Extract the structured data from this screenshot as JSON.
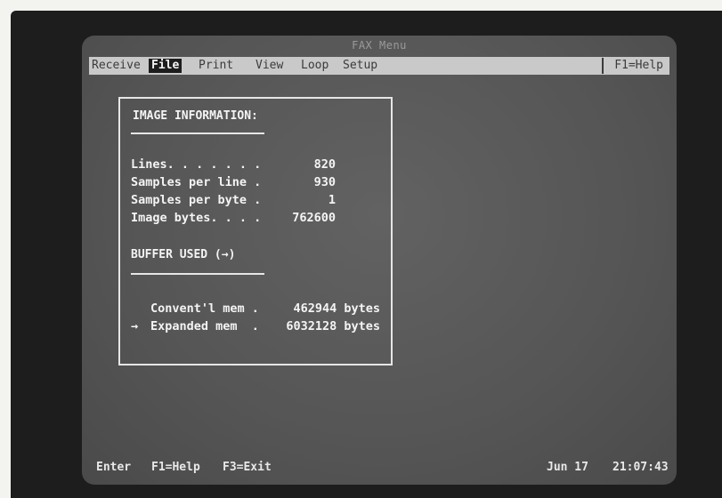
{
  "window": {
    "title": "FAX Menu"
  },
  "menu": {
    "items": [
      "Receive",
      "File",
      "Print",
      "View",
      "Loop",
      "Setup"
    ],
    "help": "F1=Help"
  },
  "image_info": {
    "title": "IMAGE INFORMATION:",
    "rows": [
      {
        "label": "Lines. . . . . . .",
        "value": "820"
      },
      {
        "label": "Samples per line .",
        "value": "930"
      },
      {
        "label": "Samples per byte .",
        "value": "1"
      },
      {
        "label": "Image bytes. . . .",
        "value": "762600"
      }
    ]
  },
  "buffer": {
    "title": "BUFFER USED (→)",
    "rows": [
      {
        "marker": "",
        "label": "Convent'l mem .",
        "value": "462944 bytes"
      },
      {
        "marker": "→",
        "label": "Expanded mem  .",
        "value": "6032128 bytes"
      }
    ]
  },
  "status_bar": {
    "enter": "Enter",
    "help": "F1=Help",
    "exit": "F3=Exit",
    "date": "Jun 17",
    "time": "21:07:43"
  }
}
